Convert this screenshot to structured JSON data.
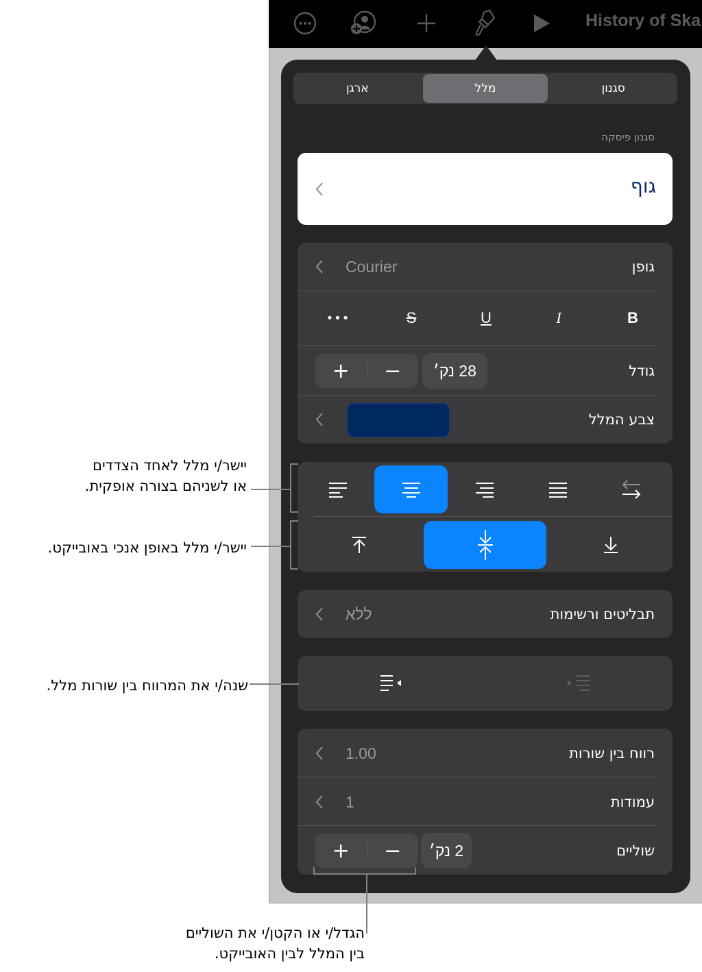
{
  "toolbar": {
    "title": "History of Ska",
    "icons": [
      "more-icon",
      "collaborate-icon",
      "add-icon",
      "format-brush-icon",
      "play-icon"
    ]
  },
  "tabs": [
    {
      "label": "ארגן",
      "active": false
    },
    {
      "label": "מלל",
      "active": true
    },
    {
      "label": "סגנון",
      "active": false
    }
  ],
  "paragraph_style": {
    "section_label": "סגנון פיסקה",
    "value": "גוף",
    "value_color": "#0a2a66"
  },
  "font": {
    "label": "גופן",
    "value": "Courier",
    "format_buttons": [
      {
        "name": "more-text-options",
        "glyph": "•••"
      },
      {
        "name": "strikethrough",
        "glyph": "S"
      },
      {
        "name": "underline",
        "glyph": "U"
      },
      {
        "name": "italic",
        "glyph": "I"
      },
      {
        "name": "bold",
        "glyph": "B"
      }
    ]
  },
  "size": {
    "label": "גודל",
    "value": "28 נק׳",
    "plus": "+",
    "minus": "−"
  },
  "text_color": {
    "label": "צבע המלל",
    "swatch": "#002861"
  },
  "alignment": {
    "horizontal": [
      "left",
      "center",
      "right",
      "justify",
      "writing-direction"
    ],
    "horizontal_selected": "center",
    "vertical": [
      "top",
      "middle",
      "bottom"
    ],
    "vertical_selected": "middle",
    "accent": "#0a84ff"
  },
  "bullets": {
    "label": "תבליטים ורשימות",
    "value": "ללא"
  },
  "indent": {
    "decrease_enabled": true,
    "increase_enabled": false
  },
  "spacing": {
    "line_spacing_label": "רווח בין שורות",
    "line_spacing_value": "1.00",
    "columns_label": "עמודות",
    "columns_value": "1",
    "margin_label": "שוליים",
    "margin_value": "2 נק׳",
    "plus": "+",
    "minus": "−"
  },
  "callouts": {
    "horizontal_line1": "יישר/י מלל לאחד הצדדים",
    "horizontal_line2": "או לשניהם בצורה אופקית.",
    "vertical": "יישר/י מלל באופן אנכי באובייקט.",
    "indent": "שנה/י את המרווח בין שורות מלל.",
    "margin_line1": "הגדל/י או הקטן/י את השוליים",
    "margin_line2": "בין המלל לבין האובייקט."
  }
}
